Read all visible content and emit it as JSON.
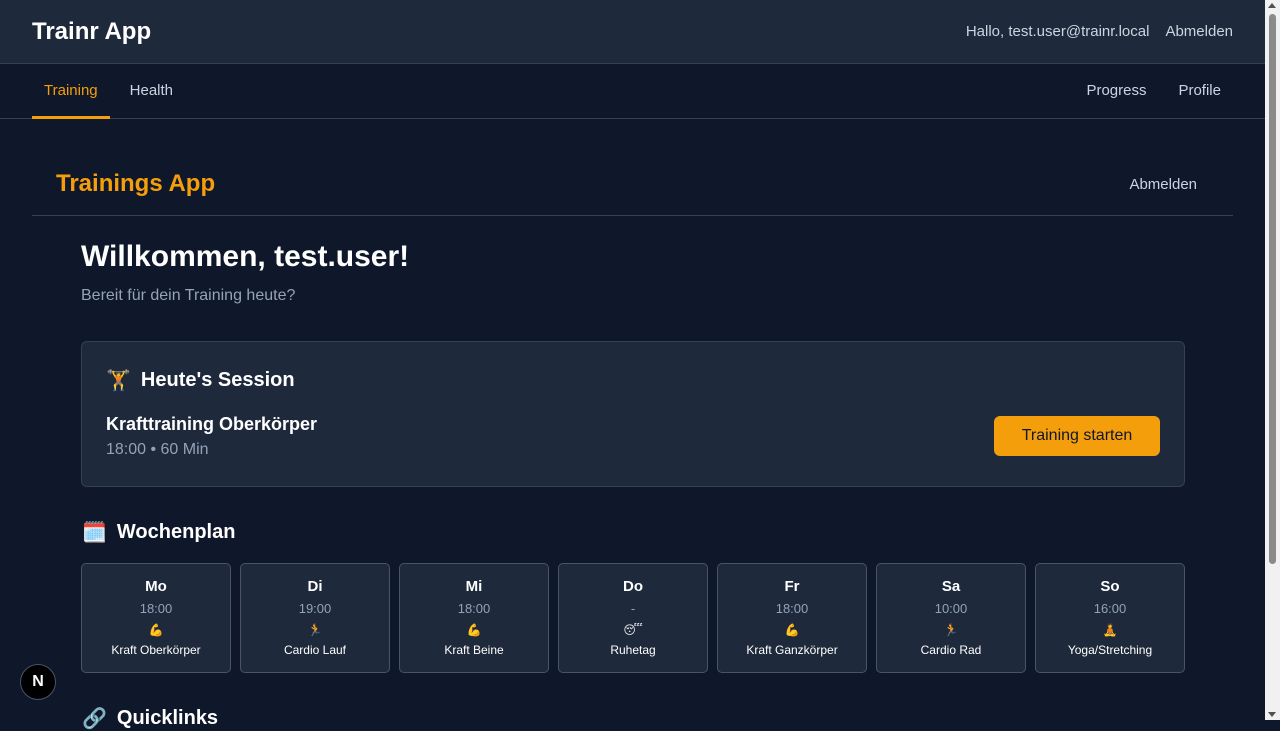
{
  "header": {
    "brand": "Trainr App",
    "greeting": "Hallo, test.user@trainr.local",
    "logout": "Abmelden"
  },
  "nav": {
    "left": [
      {
        "label": "Training",
        "active": true
      },
      {
        "label": "Health",
        "active": false
      }
    ],
    "right": [
      {
        "label": "Progress"
      },
      {
        "label": "Profile"
      }
    ]
  },
  "page": {
    "title": "Trainings App",
    "logout": "Abmelden",
    "welcome": "Willkommen, test.user!",
    "subtitle": "Bereit für dein Training heute?"
  },
  "session": {
    "icon": "🏋️",
    "heading": "Heute's Session",
    "name": "Krafttraining Oberkörper",
    "meta": "18:00 • 60 Min",
    "button": "Training starten"
  },
  "week": {
    "icon": "🗓️",
    "heading": "Wochenplan",
    "days": [
      {
        "day": "Mo",
        "time": "18:00",
        "icon": "💪",
        "activity": "Kraft Oberkörper"
      },
      {
        "day": "Di",
        "time": "19:00",
        "icon": "🏃",
        "activity": "Cardio Lauf"
      },
      {
        "day": "Mi",
        "time": "18:00",
        "icon": "💪",
        "activity": "Kraft Beine"
      },
      {
        "day": "Do",
        "time": "-",
        "icon": "😴",
        "activity": "Ruhetag"
      },
      {
        "day": "Fr",
        "time": "18:00",
        "icon": "💪",
        "activity": "Kraft Ganzkörper"
      },
      {
        "day": "Sa",
        "time": "10:00",
        "icon": "🏃",
        "activity": "Cardio Rad"
      },
      {
        "day": "So",
        "time": "16:00",
        "icon": "🧘",
        "activity": "Yoga/Stretching"
      }
    ]
  },
  "quicklinks": {
    "icon": "🔗",
    "heading": "Quicklinks"
  },
  "badge": {
    "label": "N"
  },
  "colors": {
    "accent": "#f59e0b",
    "background": "#0f172a",
    "card": "#1e293b"
  }
}
